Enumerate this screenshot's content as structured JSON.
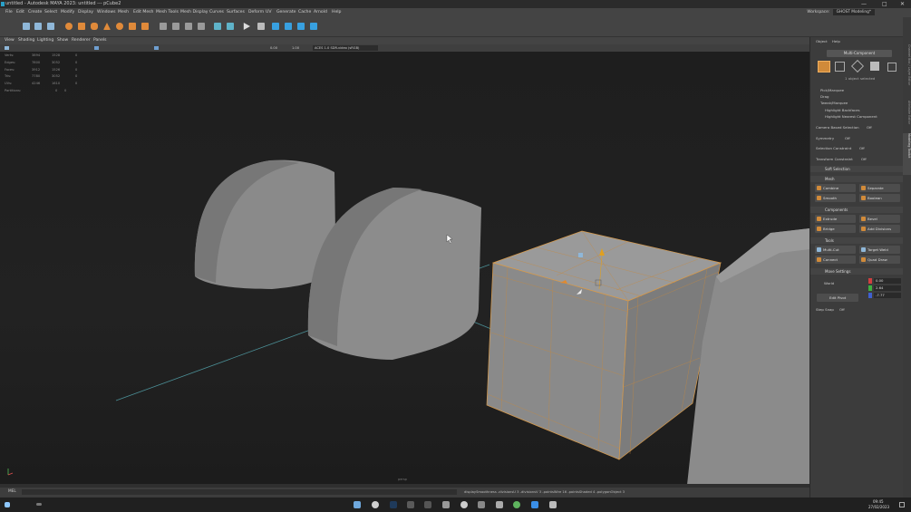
{
  "window": {
    "title": "untitled - Autodesk MAYA 2023: untitled   ---   pCube2",
    "min": "—",
    "max": "□",
    "close": "✕"
  },
  "menu": [
    "File",
    "Edit",
    "Create",
    "Select",
    "Modify",
    "Display",
    "Windows",
    "Mesh",
    "Edit Mesh",
    "Mesh Tools",
    "Mesh Display",
    "Curves",
    "Surfaces",
    "Deform",
    "UV",
    "Generate",
    "Cache",
    "Arnold",
    "Help"
  ],
  "workspace": {
    "label": "Workspace:",
    "value": "GHOST Modeling*"
  },
  "panel_menu": [
    "View",
    "Shading",
    "Lighting",
    "Show",
    "Renderer",
    "Panels"
  ],
  "viewport_toolbar": {
    "field1": "0.00",
    "field2": "1.00",
    "colorspace": "ACES 1.0 SDR-video (sRGB)"
  },
  "hud": {
    "rows": [
      {
        "label": "Verts:",
        "a": "3894",
        "b": "1528",
        "c": "0"
      },
      {
        "label": "Edges:",
        "a": "7800",
        "b": "3052",
        "c": "0"
      },
      {
        "label": "Faces:",
        "a": "3912",
        "b": "1526",
        "c": "0"
      },
      {
        "label": "Tris:",
        "a": "7780",
        "b": "3052",
        "c": "0"
      },
      {
        "label": "UVs:",
        "a": "4246",
        "b": "1610",
        "c": "0"
      }
    ],
    "partitions": {
      "label": "Partitions:",
      "a": "0",
      "b": "0"
    },
    "camera": "persp"
  },
  "command": {
    "label": "MEL",
    "help": "displaySmoothness -divisionsU 3 -divisionsV 3 -pointsWire 16 -pointsShaded 4 -polygonObject 3"
  },
  "right_panel": {
    "tabs": [
      "Object",
      "Help"
    ],
    "mode": "Multi-Component",
    "selected": "1 object selected",
    "options": [
      "Pick/Marquee",
      "Drag",
      "Tweak/Marquee"
    ],
    "checks": [
      "Highlight Backfaces",
      "Highlight Nearest Component"
    ],
    "camera_based": {
      "label": "Camera Based Selection",
      "value": "Off"
    },
    "symmetry": {
      "label": "Symmetry",
      "value": "Off"
    },
    "sel_constraint": {
      "label": "Selection Constraint",
      "value": "Off"
    },
    "transform_constraint": {
      "label": "Transform Constraint",
      "value": "Off"
    },
    "sections": {
      "soft": "Soft Selection",
      "mesh": "Mesh",
      "components": "Components",
      "tools": "Tools",
      "move": "Move Settings"
    },
    "mesh_buttons": [
      "Combine",
      "Separate",
      "Smooth",
      "Boolean"
    ],
    "component_buttons": [
      "Extrude",
      "Bevel",
      "Bridge",
      "Add Divisions"
    ],
    "tool_buttons": [
      "Multi-Cut",
      "Target Weld",
      "Connect",
      "Quad Draw"
    ],
    "move": {
      "space": "World",
      "edit_pivot": "Edit Pivot",
      "x": "0.00",
      "y": "2.64",
      "z": "-7.77"
    },
    "step_snap": {
      "label": "Step Snap",
      "value": "Off"
    }
  },
  "side_tabs": [
    "Channel Box / Layer Editor",
    "Attribute Editor",
    "Modeling Toolkit"
  ],
  "taskbar": {
    "clock": "09:45",
    "date": "27/02/2023"
  }
}
